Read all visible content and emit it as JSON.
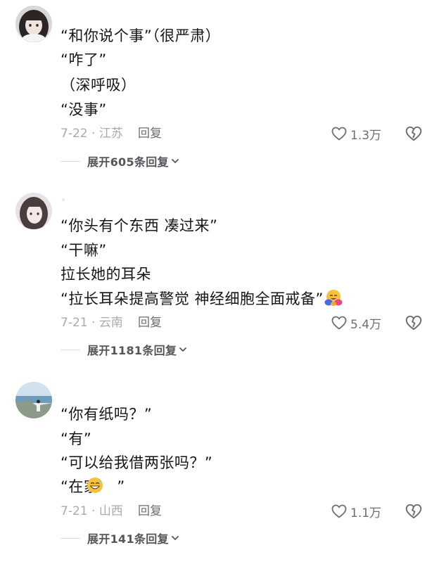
{
  "colors": {
    "text": "#161616",
    "meta": "#a9a9ae",
    "action": "#6d6d72",
    "expand": "#55555a"
  },
  "comments": [
    {
      "lines": [
        "“和你说个事”（很严肃）",
        "“咋了”",
        "（深呼吸）",
        "“没事”"
      ],
      "date": "7-22",
      "location": "江苏",
      "reply": "回复",
      "likes": "1.3万",
      "expand": "展开605条回复"
    },
    {
      "lines": [
        "“你头有个东西 凑过来”",
        "“干嘛”",
        "拉长她的耳朵",
        "“拉长耳朵提高警觉 神经细胞全面戒备”"
      ],
      "emoji": "hugging-face-emoji",
      "date": "7-21",
      "location": "云南",
      "reply": "回复",
      "likes": "5.4万",
      "expand": "展开1181条回复"
    },
    {
      "lines": [
        "“你有纸吗？”",
        "“有”",
        "“可以给我借两张吗？”",
        "“在家”"
      ],
      "emoji": "grinning-sweat-emoji",
      "date": "7-21",
      "location": "山西",
      "reply": "回复",
      "likes": "1.1万",
      "expand": "展开141条回复"
    }
  ],
  "icons": {
    "like": "heart-outline-icon",
    "dislike": "broken-heart-icon",
    "expand_chevron": "chevron-down-icon"
  }
}
